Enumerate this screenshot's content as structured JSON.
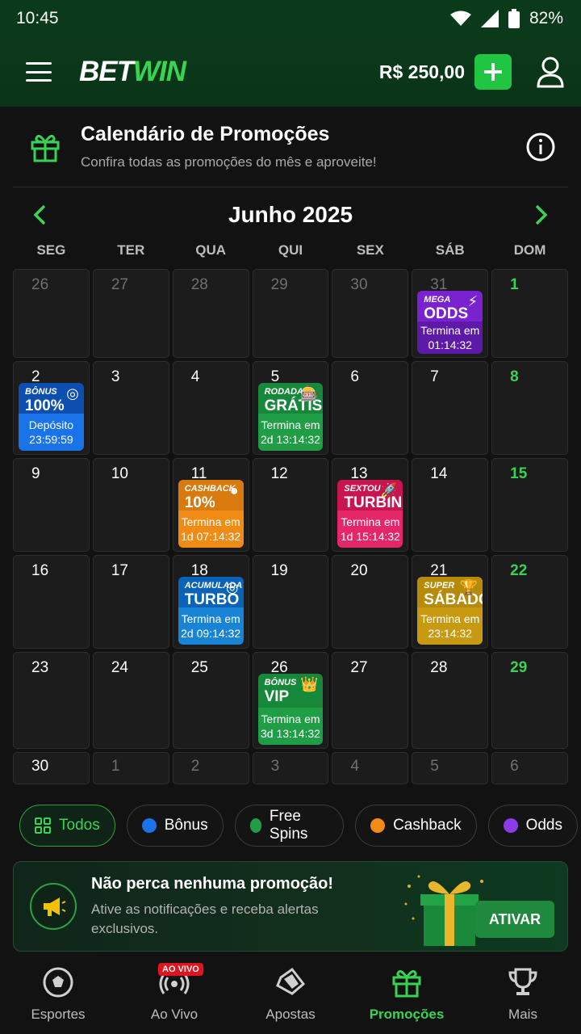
{
  "status": {
    "time": "10:45",
    "battery": "82%"
  },
  "header": {
    "logo_a": "BET",
    "logo_b": "WIN",
    "balance": "R$ 250,00"
  },
  "promo": {
    "title": "Calendário de Promoções",
    "subtitle": "Confira todas as promoções do mês e aproveite!"
  },
  "calendar": {
    "month": "Junho 2025",
    "weekdays": [
      "SEG",
      "TER",
      "QUA",
      "QUI",
      "SEX",
      "SÁB",
      "DOM"
    ],
    "cells": [
      {
        "day": "26",
        "type": "other"
      },
      {
        "day": "27",
        "type": "other"
      },
      {
        "day": "28",
        "type": "other"
      },
      {
        "day": "29",
        "type": "other"
      },
      {
        "day": "30",
        "type": "other"
      },
      {
        "day": "31",
        "type": "other",
        "promo": {
          "color": "purple",
          "l1": "MEGA",
          "l2": "ODDS",
          "badge": "⚡",
          "b1": "Termina em",
          "b2": "01:14:32"
        }
      },
      {
        "day": "1",
        "type": "sun"
      },
      {
        "day": "2",
        "promo": {
          "color": "blue",
          "l1": "BÔNUS",
          "l2": "100%",
          "badge": "◎",
          "b1": "Depósito",
          "b2": "23:59:59"
        }
      },
      {
        "day": "3"
      },
      {
        "day": "4"
      },
      {
        "day": "5",
        "promo": {
          "color": "green",
          "l1": "RODADA",
          "l2": "GRÁTIS",
          "badge": "🎰",
          "b1": "Termina em",
          "b2": "2d 13:14:32"
        }
      },
      {
        "day": "6"
      },
      {
        "day": "7"
      },
      {
        "day": "8",
        "type": "sun"
      },
      {
        "day": "9"
      },
      {
        "day": "10"
      },
      {
        "day": "11",
        "promo": {
          "color": "orange",
          "l1": "CASHBACK",
          "l2": "10%",
          "badge": "●",
          "b1": "Termina em",
          "b2": "1d 07:14:32"
        }
      },
      {
        "day": "12"
      },
      {
        "day": "13",
        "promo": {
          "color": "pink",
          "l1": "SEXTOU",
          "l2": "TURBINADO",
          "badge": "🚀",
          "b1": "Termina em",
          "b2": "1d 15:14:32"
        }
      },
      {
        "day": "14"
      },
      {
        "day": "15",
        "type": "sun"
      },
      {
        "day": "16"
      },
      {
        "day": "17"
      },
      {
        "day": "18",
        "promo": {
          "color": "cyan",
          "l1": "ACUMULADA",
          "l2": "TURBO",
          "badge": "◎",
          "b1": "Termina em",
          "b2": "2d 09:14:32"
        }
      },
      {
        "day": "19"
      },
      {
        "day": "20"
      },
      {
        "day": "21",
        "promo": {
          "color": "gold",
          "l1": "SUPER",
          "l2": "SÁBADO",
          "badge": "🏆",
          "b1": "Termina em",
          "b2": "23:14:32"
        }
      },
      {
        "day": "22",
        "type": "sun"
      },
      {
        "day": "23"
      },
      {
        "day": "24"
      },
      {
        "day": "25"
      },
      {
        "day": "26",
        "promo": {
          "color": "green",
          "l1": "BÔNUS",
          "l2": "VIP",
          "badge": "👑",
          "b1": "Termina em",
          "b2": "3d 13:14:32"
        }
      },
      {
        "day": "27"
      },
      {
        "day": "28"
      },
      {
        "day": "29",
        "type": "sun"
      },
      {
        "day": "30",
        "type": "last"
      },
      {
        "day": "1",
        "type": "other"
      },
      {
        "day": "2",
        "type": "other"
      },
      {
        "day": "3",
        "type": "other"
      },
      {
        "day": "4",
        "type": "other"
      },
      {
        "day": "5",
        "type": "other"
      },
      {
        "day": "6",
        "type": "other"
      }
    ]
  },
  "filters": [
    {
      "label": "Todos",
      "active": true
    },
    {
      "label": "Bônus",
      "color": "#1a73e8"
    },
    {
      "label": "Free Spins",
      "color": "#1f9e45"
    },
    {
      "label": "Cashback",
      "color": "#f08c15"
    },
    {
      "label": "Odds",
      "color": "#8a3ce6"
    }
  ],
  "notify": {
    "title": "Não perca nenhuma promoção!",
    "subtitle": "Ative as notificações e receba alertas exclusivos.",
    "button": "ATIVAR"
  },
  "bottom_nav": [
    {
      "label": "Esportes",
      "icon": "soccer-ball-icon"
    },
    {
      "label": "Ao Vivo",
      "icon": "live-broadcast-icon",
      "badge": "AO VIVO"
    },
    {
      "label": "Apostas",
      "icon": "ticket-icon"
    },
    {
      "label": "Promoções",
      "icon": "gift-icon",
      "active": true
    },
    {
      "label": "Mais",
      "icon": "trophy-icon"
    }
  ]
}
